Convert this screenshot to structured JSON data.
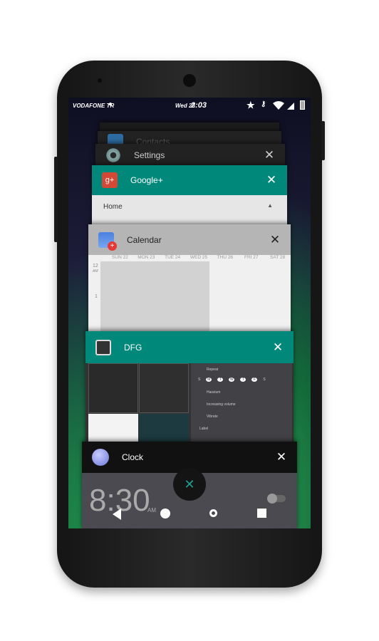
{
  "status_bar": {
    "carrier": "VODAFONE TR",
    "date": "Wed 25",
    "time": "2:03"
  },
  "recents": [
    {
      "title": "Contacts"
    },
    {
      "title": "Settings"
    },
    {
      "title": "Google+",
      "section": "Home"
    },
    {
      "title": "Calendar",
      "days": [
        "SUN 22",
        "MON 23",
        "TUE 24",
        "WED 25",
        "THU 26",
        "FRI 27",
        "SAT 28"
      ],
      "hours": [
        "12",
        "AM",
        "1",
        "2"
      ]
    },
    {
      "title": "DFG",
      "alarm_options": [
        "Repeat",
        "Hassium",
        "Increasing volume",
        "Vibrate",
        "Label"
      ],
      "weekdays": [
        "S",
        "M",
        "T",
        "W",
        "T",
        "F",
        "S"
      ]
    },
    {
      "title": "Clock",
      "alarm_time": "8:30",
      "alarm_ampm": "AM"
    }
  ],
  "colors": {
    "teal": "#00897b",
    "dark": "#111111"
  },
  "nav": {
    "icons": [
      "back-icon",
      "home-icon",
      "search-icon",
      "recents-icon"
    ]
  }
}
